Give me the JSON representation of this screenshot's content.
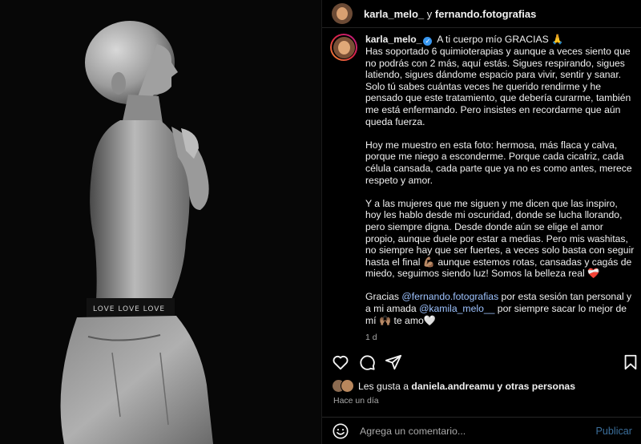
{
  "photo": {
    "waistband_text": "LOVE LOVE LOVE"
  },
  "header": {
    "user1": "karla_melo_",
    "separator": "y",
    "user2": "fernando.fotografias"
  },
  "caption": {
    "username": "karla_melo_",
    "first_line": "A ti cuerpo mío GRACIAS 🙏",
    "paragraph1_rest": "Has soportado 6 quimioterapias y aunque a veces siento que no podrás con 2 más, aquí estás. Sigues respirando, sigues latiendo, sigues dándome espacio para vivir, sentir y sanar. Solo tú sabes cuántas veces he querido rendirme y he pensado que este tratamiento, que debería curarme, también me está enfermando. Pero insistes en recordarme que aún queda fuerza.",
    "paragraph2": "Hoy me muestro en esta foto: hermosa, más flaca y calva, porque me niego a esconderme. Porque cada cicatriz, cada célula cansada, cada parte que ya no es como antes, merece respeto y amor.",
    "paragraph3_a": "Y a las mujeres que me siguen y me dicen que las inspiro, hoy les hablo desde mi oscuridad, donde se lucha llorando, pero siempre digna. Desde donde aún se elige el amor propio, aunque duele por estar a medias. Pero mis washitas, no siempre hay que ser fuertes, a veces solo basta con seguir hasta el final",
    "paragraph3_muscle": "💪🏽",
    "paragraph3_b": " aunque estemos rotas, cansadas y cagás de miedo, seguimos siendo luz!  Somos la belleza real ",
    "paragraph3_heart": "❤️‍🩹",
    "paragraph4_a": "Gracias ",
    "mention1": "@fernando.fotografias",
    "paragraph4_b": " por esta sesión tan personal y a mi amada ",
    "mention2": "@kamila_melo__",
    "paragraph4_c": " por siempre sacar lo mejor de mí ",
    "paragraph4_hands": "🙌🏽",
    "paragraph4_d": " te amo🤍",
    "time": "1 d"
  },
  "actions": {
    "like_icon": "heart-icon",
    "comment_icon": "comment-icon",
    "share_icon": "share-icon",
    "save_icon": "bookmark-icon"
  },
  "likes": {
    "prefix": "Les gusta a ",
    "user": "daniela.andreamu",
    "suffix": " y otras personas"
  },
  "posted": "Hace un día",
  "comment": {
    "placeholder": "Agrega un comentario...",
    "publish_label": "Publicar"
  },
  "colors": {
    "background": "#000000",
    "mention": "#9ec3ff",
    "publish": "#3b6e9a",
    "verified": "#3897f0"
  }
}
